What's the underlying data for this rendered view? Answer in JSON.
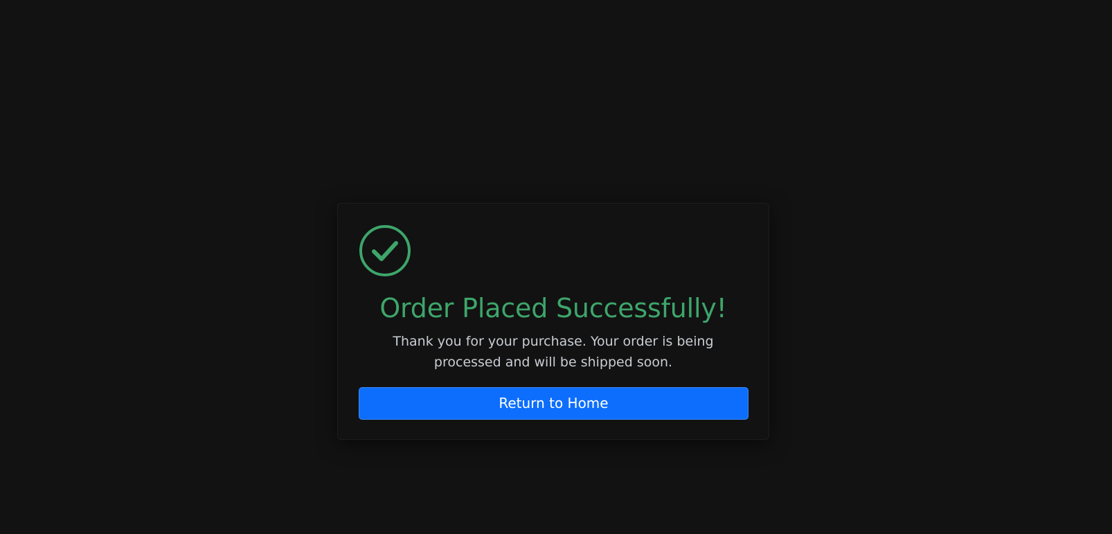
{
  "colors": {
    "page_background": "#121212",
    "success": "#3ea56b",
    "primary": "#0d6efd",
    "message_text": "#c9ced4"
  },
  "confirmation": {
    "icon": "check-circle-icon",
    "title": "Order Placed Successfully!",
    "message": "Thank you for your purchase. Your order is being processed and will be shipped soon.",
    "button_label": "Return to Home"
  }
}
